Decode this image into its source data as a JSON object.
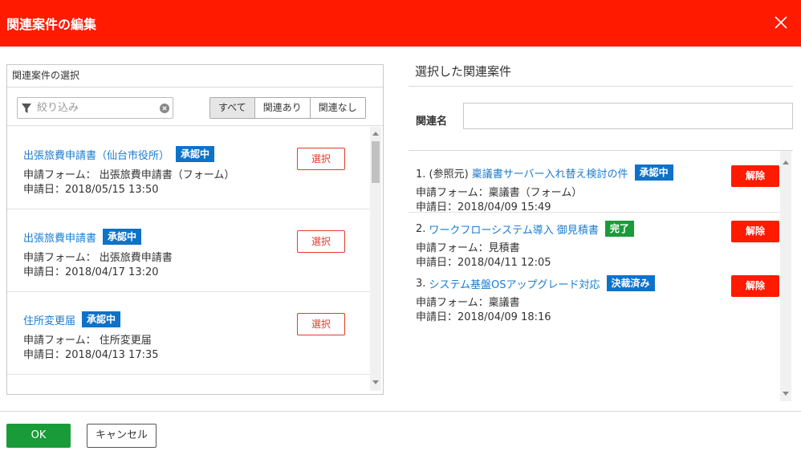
{
  "dialog": {
    "title": "関連案件の編集",
    "close_icon": "close-icon"
  },
  "left": {
    "panel_title": "関連案件の選択",
    "filter": {
      "placeholder": "絞り込み",
      "value": ""
    },
    "segments": [
      {
        "label": "すべて",
        "active": true
      },
      {
        "label": "関連あり",
        "active": false
      },
      {
        "label": "関連なし",
        "active": false
      }
    ],
    "items": [
      {
        "title": "出張旅費申請書（仙台市役所）",
        "status": "承認中",
        "form": "申請フォーム： 出張旅費申請書（フォーム）",
        "date": "申請日：2018/05/15 13:50",
        "button": "選択"
      },
      {
        "title": "出張旅費申請書",
        "status": "承認中",
        "form": "申請フォーム： 出張旅費申請書",
        "date": "申請日：2018/04/17 13:20",
        "button": "選択"
      },
      {
        "title": "住所変更届",
        "status": "承認中",
        "form": "申請フォーム： 住所変更届",
        "date": "申請日：2018/04/13 17:35",
        "button": "選択"
      }
    ]
  },
  "right": {
    "title": "選択した関連案件",
    "name_label": "関連名",
    "name_value": "",
    "items": [
      {
        "prefix": "1. (参照元)",
        "title": "稟議書サーバー入れ替え検討の件",
        "status": "承認中",
        "status_color": "#0f72c9",
        "form": "申請フォーム：稟議書（フォーム）",
        "date": "申請日：2018/04/09 15:49",
        "button": "解除"
      },
      {
        "prefix": "2.",
        "title": "ワークフローシステム導入 御見積書",
        "status": "完了",
        "status_color": "#1a9b3a",
        "form": "申請フォーム：見積書",
        "date": "申請日：2018/04/11 12:05",
        "button": "解除"
      },
      {
        "prefix": "3.",
        "title": "システム基盤OSアップグレード対応",
        "status": "決裁済み",
        "status_color": "#0f72c9",
        "form": "申請フォーム：稟議書",
        "date": "申請日：2018/04/09 18:16",
        "button": "解除"
      }
    ]
  },
  "footer": {
    "ok_label": "OK",
    "cancel_label": "キャンセル"
  },
  "colors": {
    "header": "#ff1a00",
    "link": "#1a7ccf",
    "badge_blue": "#0f72c9",
    "badge_green": "#1a9b3a",
    "remove": "#ff1a00"
  }
}
